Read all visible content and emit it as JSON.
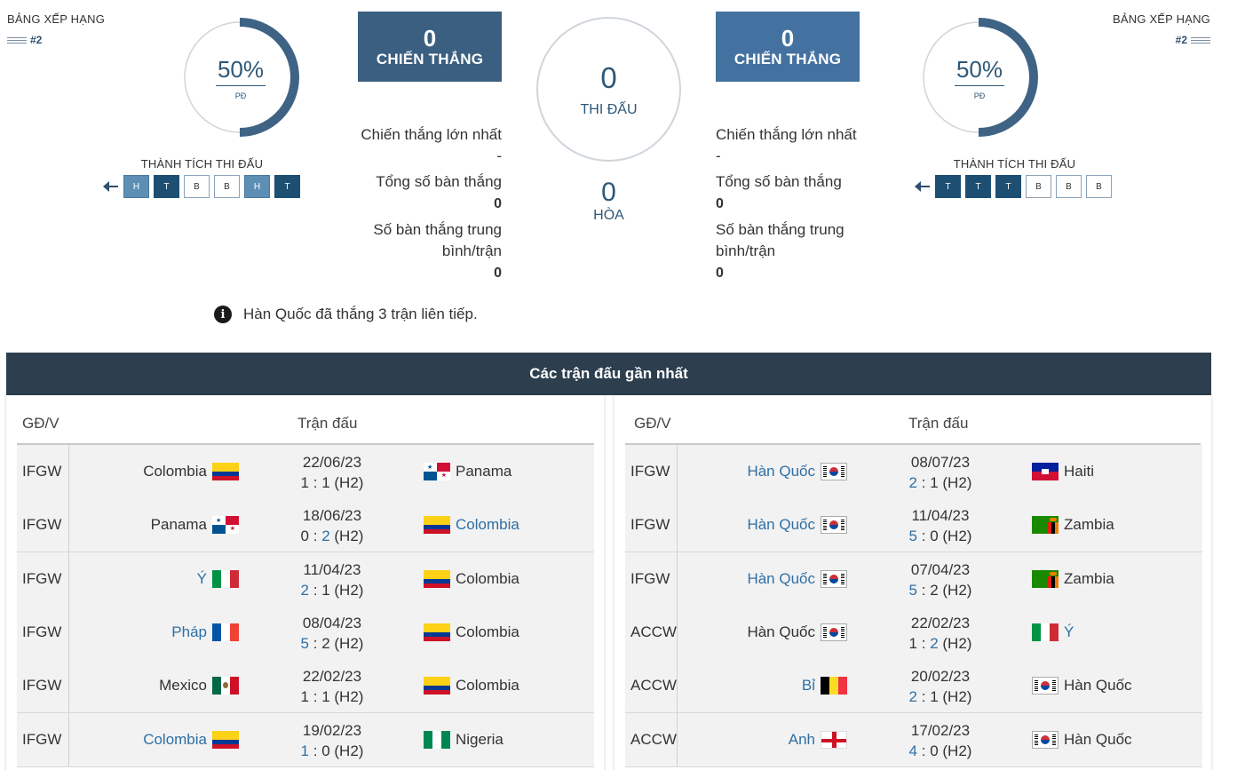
{
  "left_team": {
    "rank_label": "BẢNG XẾP HẠNG",
    "rank": "#2",
    "ring_pct": "50%",
    "ring_sub": "PĐ",
    "ring_value": 0.5,
    "form_title": "THÀNH TÍCH THI ĐẤU",
    "form": [
      "H",
      "T",
      "B",
      "B",
      "H",
      "T"
    ],
    "wins": "0",
    "wins_label": "CHIẾN THẮNG",
    "biggest_win_label": "Chiến thắng lớn nhất",
    "biggest_win": "-",
    "total_goals_label": "Tổng số bàn thắng",
    "total_goals": "0",
    "avg_goals_label_1": "Số bàn thắng trung",
    "avg_goals_label_2": "bình/trận",
    "avg_goals": "0"
  },
  "right_team": {
    "rank_label": "BẢNG XẾP HẠNG",
    "rank": "#2",
    "ring_pct": "50%",
    "ring_sub": "PĐ",
    "ring_value": 0.5,
    "form_title": "THÀNH TÍCH THI ĐẤU",
    "form": [
      "T",
      "T",
      "T",
      "B",
      "B",
      "B"
    ],
    "wins": "0",
    "wins_label": "CHIẾN THẮNG",
    "biggest_win_label": "Chiến thắng lớn nhất",
    "biggest_win": "-",
    "total_goals_label": "Tổng số bàn thắng",
    "total_goals": "0",
    "avg_goals_label_1": "Số bàn thắng trung",
    "avg_goals_label_2": "bình/trận",
    "avg_goals": "0"
  },
  "center": {
    "played": "0",
    "played_label": "THI ĐẤU",
    "draws": "0",
    "draws_label": "HÒA"
  },
  "info_text": "Hàn Quốc đã thắng 3 trận liên tiếp.",
  "section_title": "Các trận đấu gần nhất",
  "columns": {
    "stage": "GĐ/V",
    "match": "Trận đấu"
  },
  "colors": {
    "dark_bar": "#2d3e4e",
    "win": "#1d4f72",
    "draw": "#5d8fb5",
    "link": "#2e6fa5"
  },
  "left_matches": [
    {
      "comp": "IFGW",
      "home": "Colombia",
      "home_flag": "colombia",
      "date": "22/06/23",
      "hs": "1",
      "as": "1",
      "ht": "(H2)",
      "away": "Panama",
      "away_flag": "panama",
      "winner": "none"
    },
    {
      "comp": "IFGW",
      "home": "Panama",
      "home_flag": "panama",
      "date": "18/06/23",
      "hs": "0",
      "as": "2",
      "ht": "(H2)",
      "away": "Colombia",
      "away_flag": "colombia",
      "winner": "away"
    },
    {
      "comp": "IFGW",
      "home": "Ý",
      "home_flag": "italy",
      "date": "11/04/23",
      "hs": "2",
      "as": "1",
      "ht": "(H2)",
      "away": "Colombia",
      "away_flag": "colombia",
      "winner": "home"
    },
    {
      "comp": "IFGW",
      "home": "Pháp",
      "home_flag": "france",
      "date": "08/04/23",
      "hs": "5",
      "as": "2",
      "ht": "(H2)",
      "away": "Colombia",
      "away_flag": "colombia",
      "winner": "home"
    },
    {
      "comp": "IFGW",
      "home": "Mexico",
      "home_flag": "mexico",
      "date": "22/02/23",
      "hs": "1",
      "as": "1",
      "ht": "(H2)",
      "away": "Colombia",
      "away_flag": "colombia",
      "winner": "none"
    },
    {
      "comp": "IFGW",
      "home": "Colombia",
      "home_flag": "colombia",
      "date": "19/02/23",
      "hs": "1",
      "as": "0",
      "ht": "(H2)",
      "away": "Nigeria",
      "away_flag": "nigeria",
      "winner": "home"
    }
  ],
  "right_matches": [
    {
      "comp": "IFGW",
      "home": "Hàn Quốc",
      "home_flag": "korea",
      "date": "08/07/23",
      "hs": "2",
      "as": "1",
      "ht": "(H2)",
      "away": "Haiti",
      "away_flag": "haiti",
      "winner": "home"
    },
    {
      "comp": "IFGW",
      "home": "Hàn Quốc",
      "home_flag": "korea",
      "date": "11/04/23",
      "hs": "5",
      "as": "0",
      "ht": "(H2)",
      "away": "Zambia",
      "away_flag": "zambia",
      "winner": "home"
    },
    {
      "comp": "IFGW",
      "home": "Hàn Quốc",
      "home_flag": "korea",
      "date": "07/04/23",
      "hs": "5",
      "as": "2",
      "ht": "(H2)",
      "away": "Zambia",
      "away_flag": "zambia",
      "winner": "home"
    },
    {
      "comp": "ACCW",
      "home": "Hàn Quốc",
      "home_flag": "korea",
      "date": "22/02/23",
      "hs": "1",
      "as": "2",
      "ht": "(H2)",
      "away": "Ý",
      "away_flag": "italy",
      "winner": "away"
    },
    {
      "comp": "ACCW",
      "home": "Bỉ",
      "home_flag": "belgium",
      "date": "20/02/23",
      "hs": "2",
      "as": "1",
      "ht": "(H2)",
      "away": "Hàn Quốc",
      "away_flag": "korea",
      "winner": "home"
    },
    {
      "comp": "ACCW",
      "home": "Anh",
      "home_flag": "england",
      "date": "17/02/23",
      "hs": "4",
      "as": "0",
      "ht": "(H2)",
      "away": "Hàn Quốc",
      "away_flag": "korea",
      "winner": "home"
    }
  ]
}
